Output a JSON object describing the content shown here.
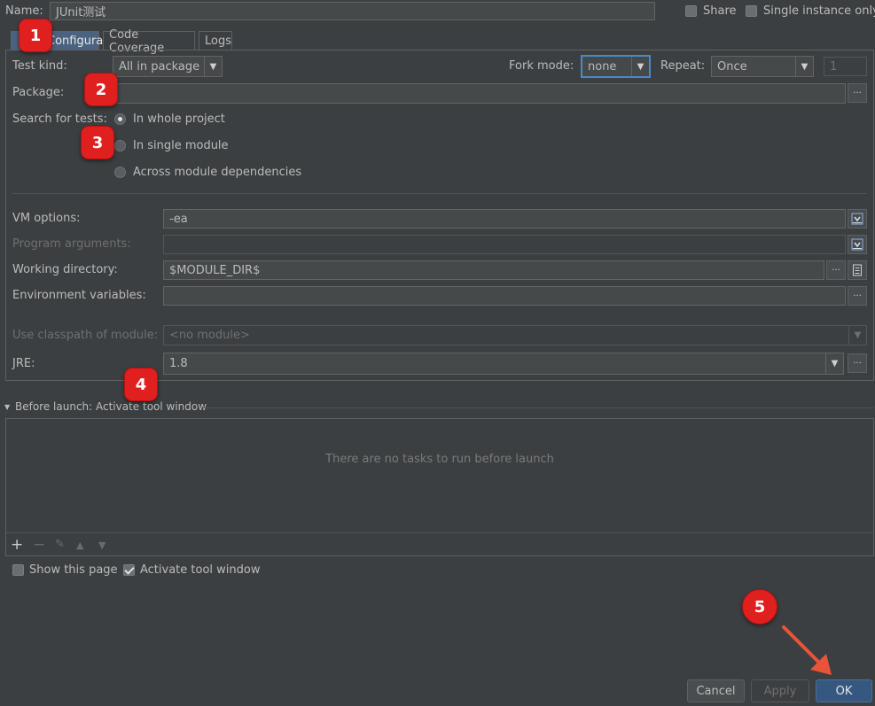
{
  "header": {
    "name_label": "Name:",
    "name_value": "JUnit测试",
    "share_label": "Share",
    "single_instance_label": "Single instance only"
  },
  "tabs": [
    {
      "label": "Configuration",
      "selected": true
    },
    {
      "label": "Code Coverage",
      "selected": false
    },
    {
      "label": "Logs",
      "selected": false
    }
  ],
  "config": {
    "test_kind_label": "Test kind:",
    "test_kind_value": "All in package",
    "fork_mode_label": "Fork mode:",
    "fork_mode_value": "none",
    "repeat_label": "Repeat:",
    "repeat_value": "Once",
    "repeat_count": "1",
    "package_label": "Package:",
    "package_value": "",
    "search_label": "Search for tests:",
    "search_options": [
      {
        "label": "In whole project",
        "selected": true
      },
      {
        "label": "In single module",
        "selected": false
      },
      {
        "label": "Across module dependencies",
        "selected": false
      }
    ],
    "vm_options_label": "VM options:",
    "vm_options_value": "-ea",
    "program_args_label": "Program arguments:",
    "program_args_value": "",
    "working_dir_label": "Working directory:",
    "working_dir_value": "$MODULE_DIR$",
    "env_vars_label": "Environment variables:",
    "env_vars_value": "",
    "classpath_label": "Use classpath of module:",
    "classpath_value": "<no module>",
    "jre_label": "JRE:",
    "jre_value": "1.8"
  },
  "before_launch": {
    "title": "Before launch: Activate tool window",
    "empty_text": "There are no tasks to run before launch",
    "toolbar_icons": [
      "plus-icon",
      "minus-icon",
      "pencil-icon",
      "arrow-up-icon",
      "arrow-down-icon"
    ]
  },
  "footer": {
    "show_page_label": "Show this page",
    "show_page_checked": false,
    "activate_label": "Activate tool window",
    "activate_checked": true
  },
  "buttons": {
    "cancel": "Cancel",
    "apply": "Apply",
    "ok": "OK"
  },
  "annotations": {
    "badge_1": "1",
    "badge_2": "2",
    "badge_3": "3",
    "badge_4": "4",
    "badge_5": "5"
  },
  "colors": {
    "background": "#3c3f41",
    "selected_tab": "#4a6381",
    "focus_border": "#4a88c7",
    "ok_button": "#365880",
    "badge_red": "#e0201f",
    "arrow_red": "#e8533a"
  },
  "icons": {
    "browse": "ellipsis-icon",
    "expand": "expand-field-icon",
    "folder": "document-icon",
    "combo": "chevron-down-icon",
    "section": "triangle-down-icon"
  }
}
